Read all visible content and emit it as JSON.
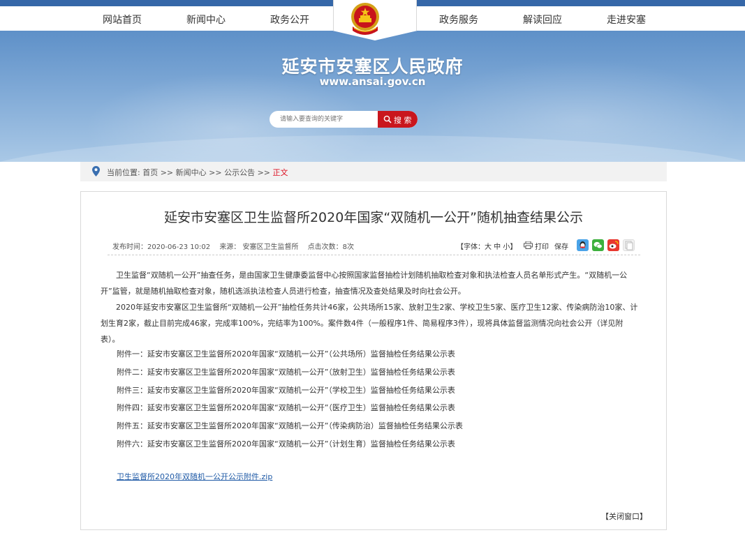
{
  "nav": {
    "items": [
      "网站首页",
      "新闻中心",
      "政务公开",
      "政务服务",
      "解读回应",
      "走进安塞"
    ]
  },
  "banner": {
    "title": "延安市安塞区人民政府",
    "url": "www.ansai.gov.cn"
  },
  "search": {
    "placeholder": "请输入要查询的关键字",
    "button": "搜 索"
  },
  "breadcrumb": {
    "prefix": "当前位置:",
    "items": [
      "首页",
      "新闻中心",
      "公示公告"
    ],
    "separator": ">>",
    "current": "正文"
  },
  "article": {
    "title": "延安市安塞区卫生监督所2020年国家“双随机一公开”随机抽查结果公示",
    "publish_time": "发布时间：2020-06-23 10:02",
    "source": "来源： 安塞区卫生监督所",
    "clicks": "点击次数：8次",
    "font_size_label": "【字体：大 中 小】",
    "print_label": "打印",
    "save_label": "保存",
    "paragraphs": [
      "卫生监督“双随机一公开”抽查任务，是由国家卫生健康委监督中心按照国家监督抽检计划随机抽取检查对象和执法检查人员名单形式产生。“双随机一公开”监管，就是随机抽取检查对象，随机选派执法检查人员进行检查，抽查情况及查处结果及时向社会公开。",
      "2020年延安市安塞区卫生监督所“双随机一公开”抽检任务共计46家，公共场所15家、放射卫生2家、学校卫生5家、医疗卫生12家、传染病防治10家、计划生育2家，截止目前完成46家，完成率100%，完结率为100%。案件数4件（一般程序1件、简易程序3件），现将具体监督监测情况向社会公开（详见附表）。"
    ],
    "attachments": [
      "附件一：延安市安塞区卫生监督所2020年国家“双随机一公开”（公共场所）监督抽检任务结果公示表",
      "附件二：延安市安塞区卫生监督所2020年国家“双随机一公开”（放射卫生）监督抽检任务结果公示表",
      "附件三：延安市安塞区卫生监督所2020年国家“双随机一公开”（学校卫生）监督抽检任务结果公示表",
      "附件四：延安市安塞区卫生监督所2020年国家“双随机一公开”（医疗卫生）监督抽检任务结果公示表",
      "附件五：延安市安塞区卫生监督所2020年国家“双随机一公开”（传染病防治）监督抽检任务结果公示表",
      "附件六：延安市安塞区卫生监督所2020年国家“双随机一公开”（计划生育）监督抽检任务结果公示表"
    ],
    "zip_link": "卫生监督所2020年双随机一公开公示附件.zip",
    "close_label": "【关闭窗口】"
  },
  "colors": {
    "top_bar": "#3567a8",
    "search_button": "#c9161d",
    "link": "#1f5aa6",
    "breadcrumb_current": "#dd1122"
  }
}
